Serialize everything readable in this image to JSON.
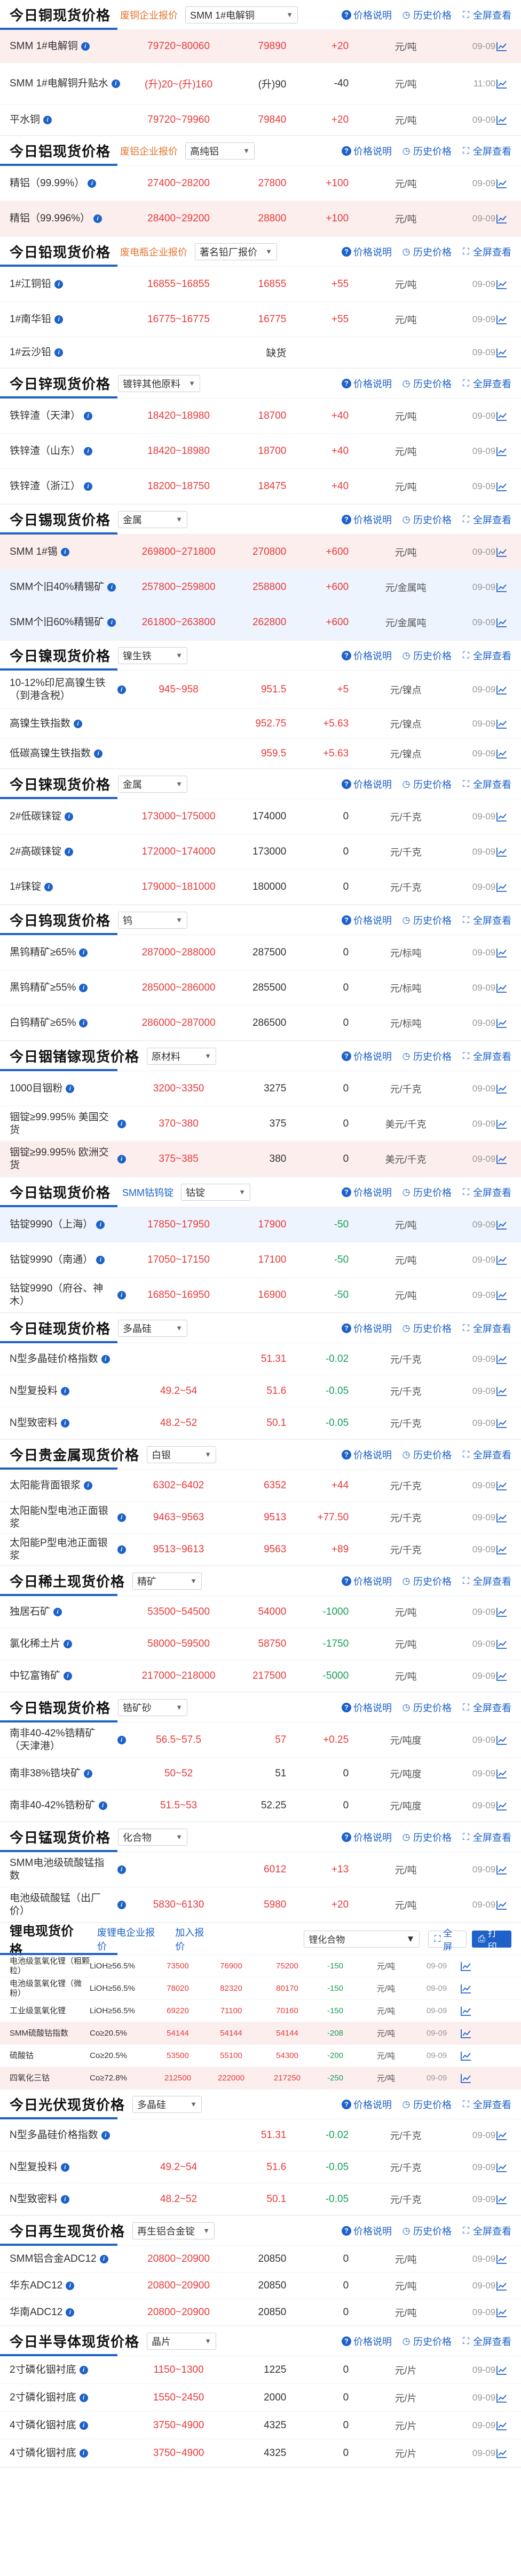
{
  "colors": {
    "accent": "#1e62c9",
    "up": "#e83a3a",
    "down": "#18a058",
    "sub": "#e0762f"
  },
  "actions": {
    "desc": "价格说明",
    "history": "历史价格",
    "fav": "全屏查看"
  },
  "sections": [
    {
      "title": "今日铜现货价格",
      "sub": "废铜企业报价",
      "select": "SMM 1#电解铜",
      "rows": [
        {
          "name": "SMM 1#电解铜",
          "range": "79720~80060",
          "avg": "79890",
          "chg": "+20",
          "unit": "元/吨",
          "date": "09-09",
          "hl": true
        },
        {
          "name": "SMM 1#电解铜升贴水",
          "range": "(升)20~(升)160",
          "avg": "(升)90",
          "chg": "-40",
          "unit": "元/吨",
          "date": "11:00",
          "dir": "down",
          "gray": true
        },
        {
          "name": "平水铜",
          "range": "79720~79960",
          "avg": "79840",
          "chg": "+20",
          "unit": "元/吨",
          "date": "09-09"
        }
      ]
    },
    {
      "title": "今日铝现货价格",
      "sub": "废铝企业报价",
      "select": "高纯铝",
      "rows": [
        {
          "name": "精铝（99.99%）",
          "range": "27400~28200",
          "avg": "27800",
          "chg": "+100",
          "unit": "元/吨",
          "date": "09-09"
        },
        {
          "name": "精铝（99.996%）",
          "range": "28400~29200",
          "avg": "28800",
          "chg": "+100",
          "unit": "元/吨",
          "date": "09-09",
          "hl": true
        }
      ]
    },
    {
      "title": "今日铅现货价格",
      "sub": "废电瓶企业报价",
      "select": "著名铅厂报价",
      "rows": [
        {
          "name": "1#江铜铅",
          "range": "16855~16855",
          "avg": "16855",
          "chg": "+55",
          "unit": "元/吨",
          "date": "09-09"
        },
        {
          "name": "1#南华铅",
          "range": "16775~16775",
          "avg": "16775",
          "chg": "+55",
          "unit": "元/吨",
          "date": "09-09"
        },
        {
          "name": "1#云沙铅",
          "range": "",
          "avg": "缺货",
          "chg": "",
          "unit": "",
          "date": "09-09",
          "gray": true
        }
      ]
    },
    {
      "title": "今日锌现货价格",
      "sub": "",
      "select": "镀锌其他原料",
      "rows": [
        {
          "name": "铁锌渣（天津）",
          "range": "18420~18980",
          "avg": "18700",
          "chg": "+40",
          "unit": "元/吨",
          "date": "09-09"
        },
        {
          "name": "铁锌渣（山东）",
          "range": "18420~18980",
          "avg": "18700",
          "chg": "+40",
          "unit": "元/吨",
          "date": "09-09"
        },
        {
          "name": "铁锌渣（浙江）",
          "range": "18200~18750",
          "avg": "18475",
          "chg": "+40",
          "unit": "元/吨",
          "date": "09-09"
        }
      ]
    },
    {
      "title": "今日锡现货价格",
      "sub": "",
      "select": "金属",
      "rows": [
        {
          "name": "SMM 1#锡",
          "range": "269800~271800",
          "avg": "270800",
          "chg": "+600",
          "unit": "元/吨",
          "date": "09-09",
          "hl": true
        },
        {
          "name": "SMM个旧40%精锡矿",
          "range": "257800~259800",
          "avg": "258800",
          "chg": "+600",
          "unit": "元/金属吨",
          "date": "09-09",
          "blue": true
        },
        {
          "name": "SMM个旧60%精锡矿",
          "range": "261800~263800",
          "avg": "262800",
          "chg": "+600",
          "unit": "元/金属吨",
          "date": "09-09",
          "blue": true
        }
      ]
    },
    {
      "title": "今日镍现货价格",
      "sub": "",
      "select": "镍生铁",
      "rows": [
        {
          "name": "10-12%印尼高镍生铁（到港含税）",
          "range": "945~958",
          "avg": "951.5",
          "chg": "+5",
          "unit": "元/镍点",
          "date": "09-09"
        },
        {
          "name": "高镍生铁指数",
          "range": "",
          "avg": "952.75",
          "chg": "+5.63",
          "unit": "元/镍点",
          "date": "09-09"
        },
        {
          "name": "低碳高镍生铁指数",
          "range": "",
          "avg": "959.5",
          "chg": "+5.63",
          "unit": "元/镍点",
          "date": "09-09"
        }
      ]
    },
    {
      "title": "今日铼现货价格",
      "sub": "",
      "select": "金属",
      "rows": [
        {
          "name": "2#低碳铼锭",
          "range": "173000~175000",
          "avg": "174000",
          "chg": "0",
          "unit": "元/千克",
          "date": "09-09",
          "gray": true
        },
        {
          "name": "2#高碳铼锭",
          "range": "172000~174000",
          "avg": "173000",
          "chg": "0",
          "unit": "元/千克",
          "date": "09-09",
          "gray": true
        },
        {
          "name": "1#铼锭",
          "range": "179000~181000",
          "avg": "180000",
          "chg": "0",
          "unit": "元/千克",
          "date": "09-09",
          "gray": true
        }
      ]
    },
    {
      "title": "今日钨现货价格",
      "sub": "",
      "select": "钨",
      "rows": [
        {
          "name": "黑钨精矿≥65%",
          "range": "287000~288000",
          "avg": "287500",
          "chg": "0",
          "unit": "元/标吨",
          "date": "09-09",
          "gray": true
        },
        {
          "name": "黑钨精矿≥55%",
          "range": "285000~286000",
          "avg": "285500",
          "chg": "0",
          "unit": "元/标吨",
          "date": "09-09",
          "gray": true
        },
        {
          "name": "白钨精矿≥65%",
          "range": "286000~287000",
          "avg": "286500",
          "chg": "0",
          "unit": "元/标吨",
          "date": "09-09",
          "gray": true
        }
      ]
    },
    {
      "title": "今日铟锗镓现货价格",
      "sub": "",
      "select": "原材料",
      "rows": [
        {
          "name": "1000目铟粉",
          "range": "3200~3350",
          "avg": "3275",
          "chg": "0",
          "unit": "元/千克",
          "date": "09-09",
          "gray": true
        },
        {
          "name": "铟锭≥99.995% 美国交货",
          "range": "370~380",
          "avg": "375",
          "chg": "0",
          "unit": "美元/千克",
          "date": "09-09",
          "gray": true
        },
        {
          "name": "铟锭≥99.995% 欧洲交货",
          "range": "375~385",
          "avg": "380",
          "chg": "0",
          "unit": "美元/千克",
          "date": "09-09",
          "gray": true,
          "hl": true
        }
      ]
    },
    {
      "title": "今日钴现货价格",
      "sub": "SMM钴钨锭",
      "select": "钴锭",
      "rows": [
        {
          "name": "钴锭9990（上海）",
          "range": "17850~17950",
          "avg": "17900",
          "chg": "-50",
          "unit": "元/吨",
          "date": "09-09",
          "dir": "down",
          "blue": true
        },
        {
          "name": "钴锭9990（南通）",
          "range": "17050~17150",
          "avg": "17100",
          "chg": "-50",
          "unit": "元/吨",
          "date": "09-09",
          "dir": "down"
        },
        {
          "name": "钴锭9990（府谷、神木）",
          "range": "16850~16950",
          "avg": "16900",
          "chg": "-50",
          "unit": "元/吨",
          "date": "09-09",
          "dir": "down"
        }
      ]
    },
    {
      "title": "今日硅现货价格",
      "sub": "",
      "select": "多晶硅",
      "rows": [
        {
          "name": "N型多晶硅价格指数",
          "range": "",
          "avg": "51.31",
          "chg": "-0.02",
          "unit": "元/千克",
          "date": "09-09",
          "dir": "down"
        },
        {
          "name": "N型复投料",
          "range": "49.2~54",
          "avg": "51.6",
          "chg": "-0.05",
          "unit": "元/千克",
          "date": "09-09",
          "dir": "down"
        },
        {
          "name": "N型致密料",
          "range": "48.2~52",
          "avg": "50.1",
          "chg": "-0.05",
          "unit": "元/千克",
          "date": "09-09",
          "dir": "down"
        }
      ]
    },
    {
      "title": "今日贵金属现货价格",
      "sub": "",
      "select": "白银",
      "rows": [
        {
          "name": "太阳能背面银浆",
          "range": "6302~6402",
          "avg": "6352",
          "chg": "+44",
          "unit": "元/千克",
          "date": "09-09"
        },
        {
          "name": "太阳能N型电池正面银浆",
          "range": "9463~9563",
          "avg": "9513",
          "chg": "+77.50",
          "unit": "元/千克",
          "date": "09-09"
        },
        {
          "name": "太阳能P型电池正面银浆",
          "range": "9513~9613",
          "avg": "9563",
          "chg": "+89",
          "unit": "元/千克",
          "date": "09-09"
        }
      ]
    },
    {
      "title": "今日稀土现货价格",
      "sub": "",
      "select": "精矿",
      "rows": [
        {
          "name": "独居石矿",
          "range": "53500~54500",
          "avg": "54000",
          "chg": "-1000",
          "unit": "元/吨",
          "date": "09-09",
          "dir": "down"
        },
        {
          "name": "氯化稀土片",
          "range": "58000~59500",
          "avg": "58750",
          "chg": "-1750",
          "unit": "元/吨",
          "date": "09-09",
          "dir": "down"
        },
        {
          "name": "中钇富铕矿",
          "range": "217000~218000",
          "avg": "217500",
          "chg": "-5000",
          "unit": "元/吨",
          "date": "09-09",
          "dir": "down"
        }
      ]
    },
    {
      "title": "今日锆现货价格",
      "sub": "",
      "select": "锆矿砂",
      "rows": [
        {
          "name": "南非40-42%锆精矿（天津港）",
          "range": "56.5~57.5",
          "avg": "57",
          "chg": "+0.25",
          "unit": "元/吨度",
          "date": "09-09"
        },
        {
          "name": "南非38%锆块矿",
          "range": "50~52",
          "avg": "51",
          "chg": "0",
          "unit": "元/吨度",
          "date": "09-09",
          "gray": true
        },
        {
          "name": "南非40-42%锆粉矿",
          "range": "51.5~53",
          "avg": "52.25",
          "chg": "0",
          "unit": "元/吨度",
          "date": "09-09",
          "gray": true
        }
      ]
    },
    {
      "title": "今日锰现货价格",
      "sub": "",
      "select": "化合物",
      "rows": [
        {
          "name": "SMM电池级硫酸锰指数",
          "range": "",
          "avg": "6012",
          "chg": "+13",
          "unit": "元/吨",
          "date": "09-09"
        },
        {
          "name": "电池级硫酸锰（出厂价）",
          "range": "5830~6130",
          "avg": "5980",
          "chg": "+20",
          "unit": "元/吨",
          "date": "09-09"
        }
      ]
    }
  ],
  "lithium": {
    "title": "锂电现货价格",
    "link1": "废锂电企业报价",
    "link2": "加入报价",
    "select": "锂化合物",
    "btn1": "全屏",
    "btn2": "打印",
    "rows": [
      {
        "name": "电池级氢氧化锂（粗颗粒）",
        "spec": "LiOH≥56.5%",
        "lo": "73500",
        "hi": "76900",
        "avg": "75200",
        "chg": "-150",
        "unit": "元/吨",
        "date": "09-09",
        "dir": "down"
      },
      {
        "name": "电池级氢氧化锂（微粉）",
        "spec": "LiOH≥56.5%",
        "lo": "78020",
        "hi": "82320",
        "avg": "80170",
        "chg": "-150",
        "unit": "元/吨",
        "date": "09-09",
        "dir": "down"
      },
      {
        "name": "工业级氢氧化锂",
        "spec": "LiOH≥56.5%",
        "lo": "69220",
        "hi": "71100",
        "avg": "70160",
        "chg": "-150",
        "unit": "元/吨",
        "date": "09-09",
        "dir": "down"
      },
      {
        "name": "SMM硫酸钴指数",
        "spec": "Co≥20.5%",
        "lo": "54144",
        "hi": "54144",
        "avg": "54144",
        "chg": "-208",
        "unit": "元/吨",
        "date": "09-09",
        "dir": "down",
        "hl": true
      },
      {
        "name": "硫酸钴",
        "spec": "Co≥20.5%",
        "lo": "53500",
        "hi": "55100",
        "avg": "54300",
        "chg": "-200",
        "unit": "元/吨",
        "date": "09-09",
        "dir": "down"
      },
      {
        "name": "四氧化三钴",
        "spec": "Co≥72.8%",
        "lo": "212500",
        "hi": "222000",
        "avg": "217250",
        "chg": "-250",
        "unit": "元/吨",
        "date": "09-09",
        "dir": "down",
        "hl": true
      }
    ]
  },
  "sections2": [
    {
      "title": "今日光伏现货价格",
      "sub": "",
      "select": "多晶硅",
      "rows": [
        {
          "name": "N型多晶硅价格指数",
          "range": "",
          "avg": "51.31",
          "chg": "-0.02",
          "unit": "元/千克",
          "date": "09-09",
          "dir": "down"
        },
        {
          "name": "N型复投料",
          "range": "49.2~54",
          "avg": "51.6",
          "chg": "-0.05",
          "unit": "元/千克",
          "date": "09-09",
          "dir": "down"
        },
        {
          "name": "N型致密料",
          "range": "48.2~52",
          "avg": "50.1",
          "chg": "-0.05",
          "unit": "元/千克",
          "date": "09-09",
          "dir": "down"
        }
      ]
    },
    {
      "title": "今日再生现货价格",
      "sub": "",
      "select": "再生铝合金锭",
      "rows": [
        {
          "name": "SMM铝合金ADC12",
          "range": "20800~20900",
          "avg": "20850",
          "chg": "0",
          "unit": "元/吨",
          "date": "09-09",
          "gray": true
        },
        {
          "name": "华东ADC12",
          "range": "20800~20900",
          "avg": "20850",
          "chg": "0",
          "unit": "元/吨",
          "date": "09-09",
          "gray": true
        },
        {
          "name": "华南ADC12",
          "range": "20800~20900",
          "avg": "20850",
          "chg": "0",
          "unit": "元/吨",
          "date": "09-09",
          "gray": true
        }
      ]
    },
    {
      "title": "今日半导体现货价格",
      "sub": "",
      "select": "晶片",
      "rows": [
        {
          "name": "2寸磷化铟衬底",
          "range": "1150~1300",
          "avg": "1225",
          "chg": "0",
          "unit": "元/片",
          "date": "09-09",
          "gray": true
        },
        {
          "name": "2寸磷化铟衬底",
          "range": "1550~2450",
          "avg": "2000",
          "chg": "0",
          "unit": "元/片",
          "date": "09-09",
          "gray": true
        },
        {
          "name": "4寸磷化铟衬底",
          "range": "3750~4900",
          "avg": "4325",
          "chg": "0",
          "unit": "元/片",
          "date": "09-09",
          "gray": true
        },
        {
          "name": "4寸磷化铟衬底",
          "range": "3750~4900",
          "avg": "4325",
          "chg": "0",
          "unit": "元/片",
          "date": "09-09",
          "gray": true
        }
      ]
    }
  ]
}
